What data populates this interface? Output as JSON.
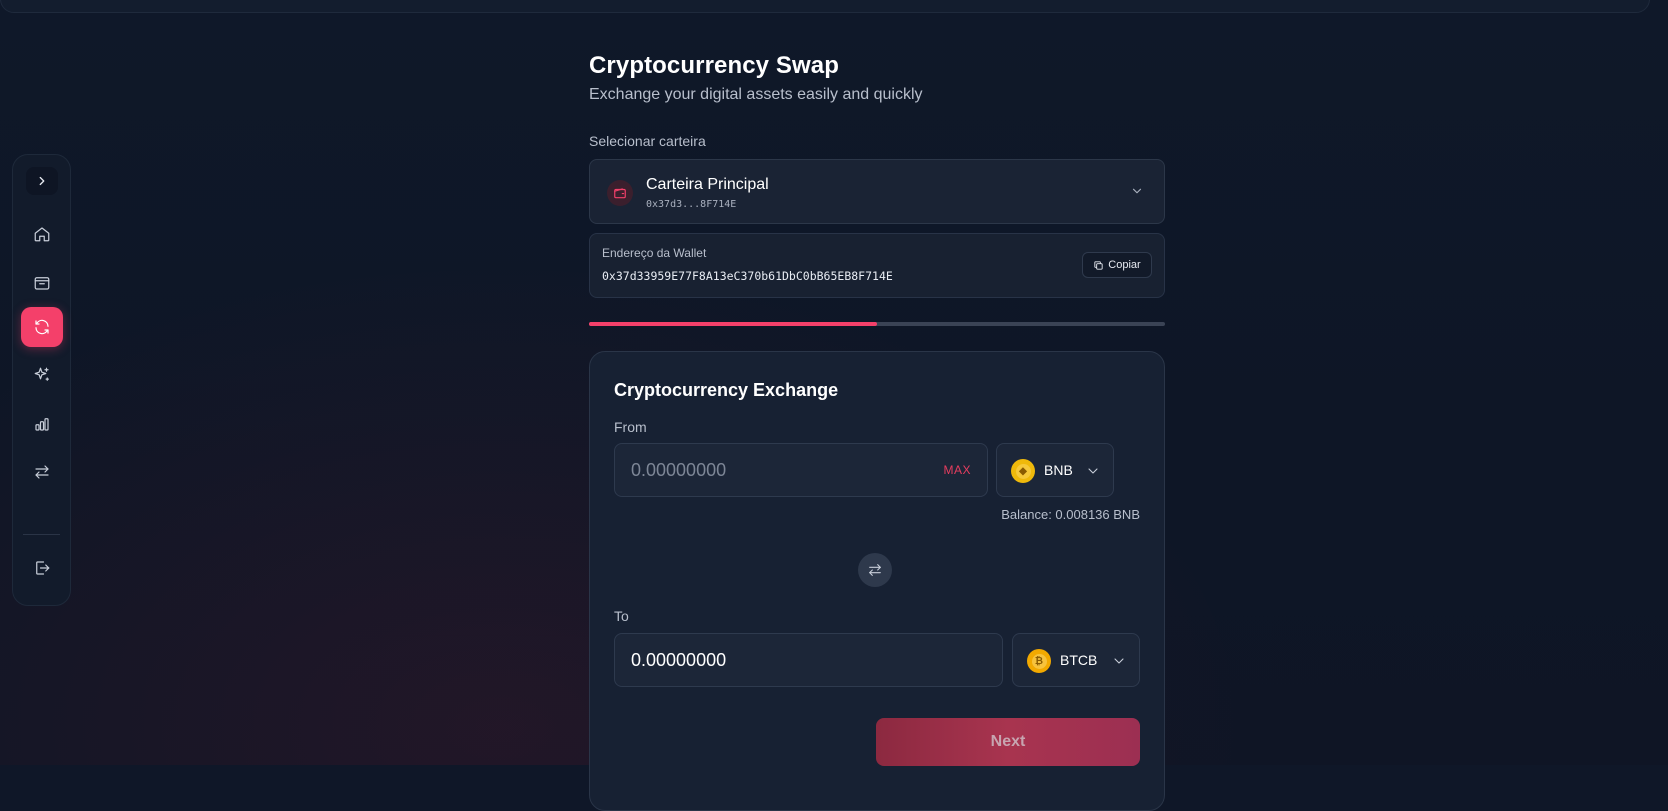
{
  "sidebar": {
    "toggle_icon": "chevron-right-icon",
    "items": [
      {
        "name": "home",
        "icon": "home-icon",
        "active": false
      },
      {
        "name": "wallet",
        "icon": "wallet-icon",
        "active": false
      },
      {
        "name": "swap",
        "icon": "refresh-icon",
        "active": true
      },
      {
        "name": "sparkles",
        "icon": "sparkles-icon",
        "active": false
      },
      {
        "name": "charts",
        "icon": "bar-chart-icon",
        "active": false
      },
      {
        "name": "transfer",
        "icon": "arrows-left-right-icon",
        "active": false
      }
    ],
    "logout_icon": "logout-icon",
    "accent_color": "#f4406a"
  },
  "header": {
    "title": "Cryptocurrency Swap",
    "subtitle": "Exchange your digital assets easily and quickly"
  },
  "wallet": {
    "label": "Selecionar carteira",
    "name": "Carteira Principal",
    "short_address": "0x37d3...8F714E",
    "address_label": "Endereço da Wallet",
    "address": "0x37d33959E77F8A13eC370b61DbC0bB65EB8F714E",
    "copy_label": "Copiar"
  },
  "progress": {
    "fraction": 0.5
  },
  "exchange": {
    "title": "Cryptocurrency Exchange",
    "from_label": "From",
    "from_placeholder": "0.00000000",
    "max_label": "MAX",
    "from_token": "BNB",
    "balance": "Balance: 0.008136 BNB",
    "to_label": "To",
    "to_value": "0.00000000",
    "to_token": "BTCB",
    "next_label": "Next"
  }
}
